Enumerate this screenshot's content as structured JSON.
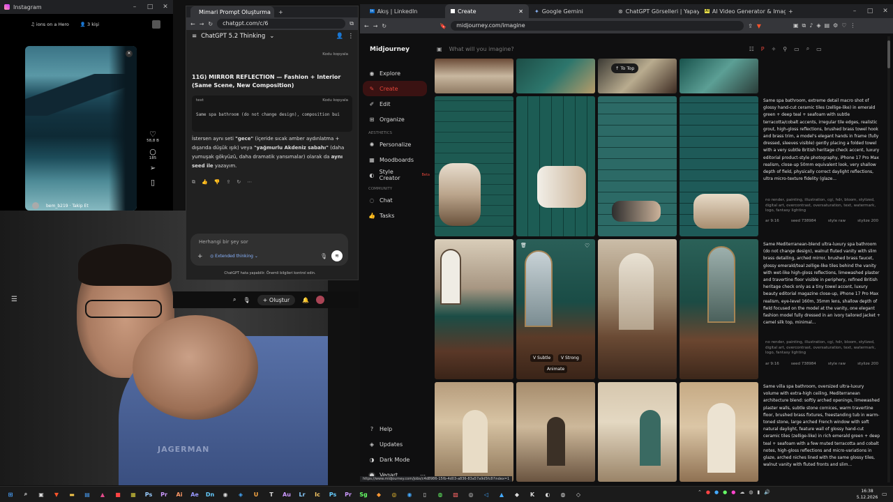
{
  "instagram": {
    "tab_title": "Instagram",
    "collab_label": "ions on a Hero",
    "count_label": "3 kişi",
    "like_count": "58,8 B",
    "comment_count": "185",
    "username": "bem_b219 · Takip Et"
  },
  "chatgpt": {
    "tab_title": "Mimari Prompt Oluşturma",
    "url": "chatgpt.com/c/6",
    "model_label": "ChatGPT 5.2 Thinking",
    "copy_label": "Kodu kopyala",
    "section_heading": "11G) MIRROR REFLECTION — Fashion + Interior (Same Scene, New Composition)",
    "code_lang": "text",
    "code_text": "Same spa bathroom (do not change design), composition bui",
    "message_plain": "İstersen aynı seti ",
    "message_q1": "\"gece\"",
    "message_mid": " (içeride sıcak amber aydınlatma + dışarıda düşük ışık) veya ",
    "message_q2": "\"yağmurlu Akdeniz sabahı\"",
    "message_end": " (daha yumuşak gökyüzü, daha dramatik yansımalar) olarak da ",
    "message_bold": "aynı seed ile",
    "message_tail": " yazayım.",
    "input_placeholder": "Herhangi bir şey sor",
    "extended_thinking": "Extended thinking",
    "disclaimer": "ChatGPT hata yapabilir. Önemli bilgileri kontrol edin."
  },
  "youtube": {
    "create_label": "Oluştur",
    "watermark": "JAGERMAN"
  },
  "midjourney": {
    "tabs": [
      "Akış | LinkedIn",
      "Create",
      "Google Gemini",
      "ChatGPT Görselleri | Yapay Zeka Gö",
      "AI Video Generator & Image Generat"
    ],
    "url": "midjourney.com/imagine",
    "brand": "Midjourney",
    "search_placeholder": "What will you imagine?",
    "nav": {
      "explore": "Explore",
      "create": "Create",
      "edit": "Edit",
      "organize": "Organize",
      "aesthetics_header": "AESTHETICS",
      "personalize": "Personalize",
      "moodboards": "Moodboards",
      "style_creator": "Style Creator",
      "beta": "Beta",
      "community_header": "COMMUNITY",
      "chat": "Chat",
      "tasks": "Tasks",
      "help": "Help",
      "updates": "Updates",
      "dark_mode": "Dark Mode",
      "user": "Vegart"
    },
    "to_top": "To Top",
    "vary_subtle": "V Subtle",
    "vary_strong": "V Strong",
    "animate": "Animate",
    "prompt1": "Same spa bathroom, extreme detail macro shot of glossy hand-cut ceramic tiles (zellige-like) in emerald green + deep teal + seafoam with subtle terracotta/cobalt accents, irregular tile edges, realistic grout, high-gloss reflections, brushed brass towel hook and brass trim, a model's elegant hands in frame (fully dressed, sleeves visible) gently placing a folded towel with a very subtle British heritage check accent, luxury editorial product-style photography, iPhone 17 Pro Max realism, close-up 50mm equivalent look, very shallow depth of field, physically correct daylight reflections, ultra micro-texture fidelity (glaze...",
    "prompt2": "Same Mediterranean-blend ultra-luxury spa bathroom (do not change design), walnut fluted vanity with slim brass detailing, arched mirror, brushed brass faucet, glossy emerald/teal zellige-like tiles behind the vanity with wet-like high-gloss reflections, limewashed plaster and travertine floor visible in periphery, refined British heritage check only as a tiny towel accent, luxury beauty editorial magazine close-up, iPhone 17 Pro Max realism, eye-level 160m, 35mm lens, shallow depth of field focused on the model at the vanity, one elegant fashion model fully dressed in an ivory tailored jacket + camel silk top, minimal...",
    "prompt3": "Same villa spa bathroom, oversized ultra-luxury volume with extra-high ceiling, Mediterranean architecture blend: softly arched openings, limewashed plaster walls, subtle stone cornices, warm travertine floor, brushed brass fixtures, freestanding tub in warm-toned stone, large arched French window with soft natural daylight, feature wall of glossy hand-cut ceramic tiles (zellige-like) in rich emerald green + deep teal + seafoam with a few muted terracotta and cobalt notes, high-gloss reflections and micro-variations in glaze, arched niches lined with the same glossy tiles, walnut vanity with fluted fronts and slim...",
    "negative_meta": "no render, painting, illustration, cgi, hdr, bloom, stylized, digital art, overcontrast, oversaturation, text, watermark, logo, fantasy lighting",
    "seed_label": "ar 9:16",
    "seed_value": "seed 738984",
    "style_raw": "style raw",
    "stylize": "stylize 200",
    "status_url": "https://www.midjourney.com/jobs/c4d8986-15fb-4d03-a836-83a57a9d5fc8?index=1"
  },
  "taskbar": {
    "time": "16:38",
    "date": "5.12.2026"
  },
  "colors": {
    "accent_red": "#e3453a",
    "emerald": "#1f5e55",
    "teal": "#2b6f6a"
  }
}
